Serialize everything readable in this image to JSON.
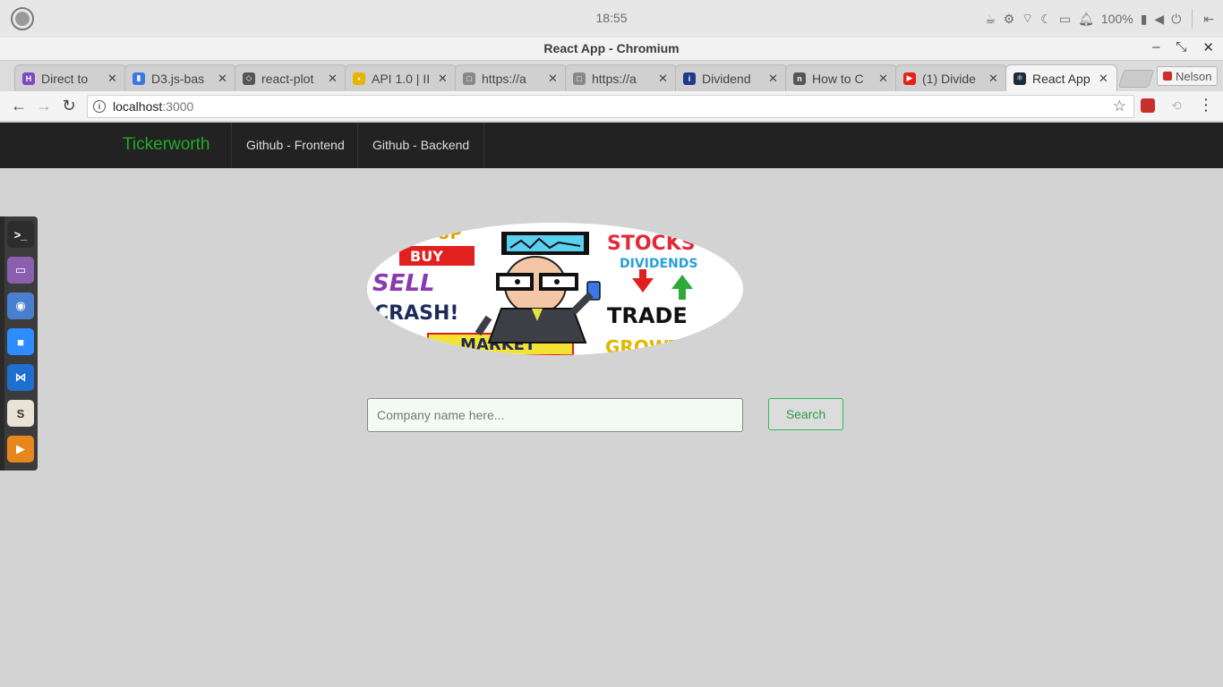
{
  "os": {
    "clock": "18:55",
    "battery": "100%"
  },
  "window": {
    "title": "React App - Chromium"
  },
  "tabs": [
    {
      "label": "Direct to",
      "favicon_color": "#7b4bbf",
      "favicon_glyph": "H"
    },
    {
      "label": "D3.js-bas",
      "favicon_color": "#3b78e7",
      "favicon_glyph": "▮"
    },
    {
      "label": "react-plot",
      "favicon_color": "#555555",
      "favicon_glyph": "◇"
    },
    {
      "label": "API 1.0 | II",
      "favicon_color": "#e8b400",
      "favicon_glyph": "▪"
    },
    {
      "label": "https://a",
      "favicon_color": "#888888",
      "favicon_glyph": "□"
    },
    {
      "label": "https://a",
      "favicon_color": "#888888",
      "favicon_glyph": "□"
    },
    {
      "label": "Dividend",
      "favicon_color": "#1f3a8a",
      "favicon_glyph": "i"
    },
    {
      "label": "How to C",
      "favicon_color": "#555555",
      "favicon_glyph": "n"
    },
    {
      "label": "(1) Divide",
      "favicon_color": "#e62117",
      "favicon_glyph": "▶"
    },
    {
      "label": "React App",
      "favicon_color": "#1b2b3a",
      "favicon_glyph": "⚛"
    }
  ],
  "active_tab_index": 9,
  "profile": {
    "label": "Nelson"
  },
  "address_bar": {
    "host": "localhost",
    "port": ":3000"
  },
  "launcher": [
    {
      "name": "terminal-icon",
      "color": "#2d2d2d",
      "glyph": ">_"
    },
    {
      "name": "files-icon",
      "color": "#8a5fae",
      "glyph": "▭"
    },
    {
      "name": "chromium-icon",
      "color": "#4a7fd0",
      "glyph": "◉"
    },
    {
      "name": "zoom-icon",
      "color": "#2d8cff",
      "glyph": "■"
    },
    {
      "name": "vscode-icon",
      "color": "#1e6fcf",
      "glyph": "⋈"
    },
    {
      "name": "slack-icon",
      "color": "#e9e3d6",
      "glyph": "S"
    },
    {
      "name": "vlc-icon",
      "color": "#e7861b",
      "glyph": "▶"
    }
  ],
  "navbar": {
    "brand": "Tickerworth",
    "links": [
      "Github - Frontend",
      "Github - Backend"
    ]
  },
  "search": {
    "placeholder": "Company name here...",
    "button_label": "Search"
  },
  "logo_text": {
    "stocks": "STOCKS",
    "dividends": "DIVIDENDS",
    "buy": "BUY",
    "sell": "SELL",
    "crash": "CRASH!",
    "trade": "TRADE",
    "market": "MARKET",
    "growth": "GROWTH",
    "up": "UP"
  },
  "colors": {
    "brand_green": "#22aa2a",
    "navbar_bg": "#222222",
    "page_bg": "#d3d3d3",
    "search_accent": "#2fbb55"
  }
}
